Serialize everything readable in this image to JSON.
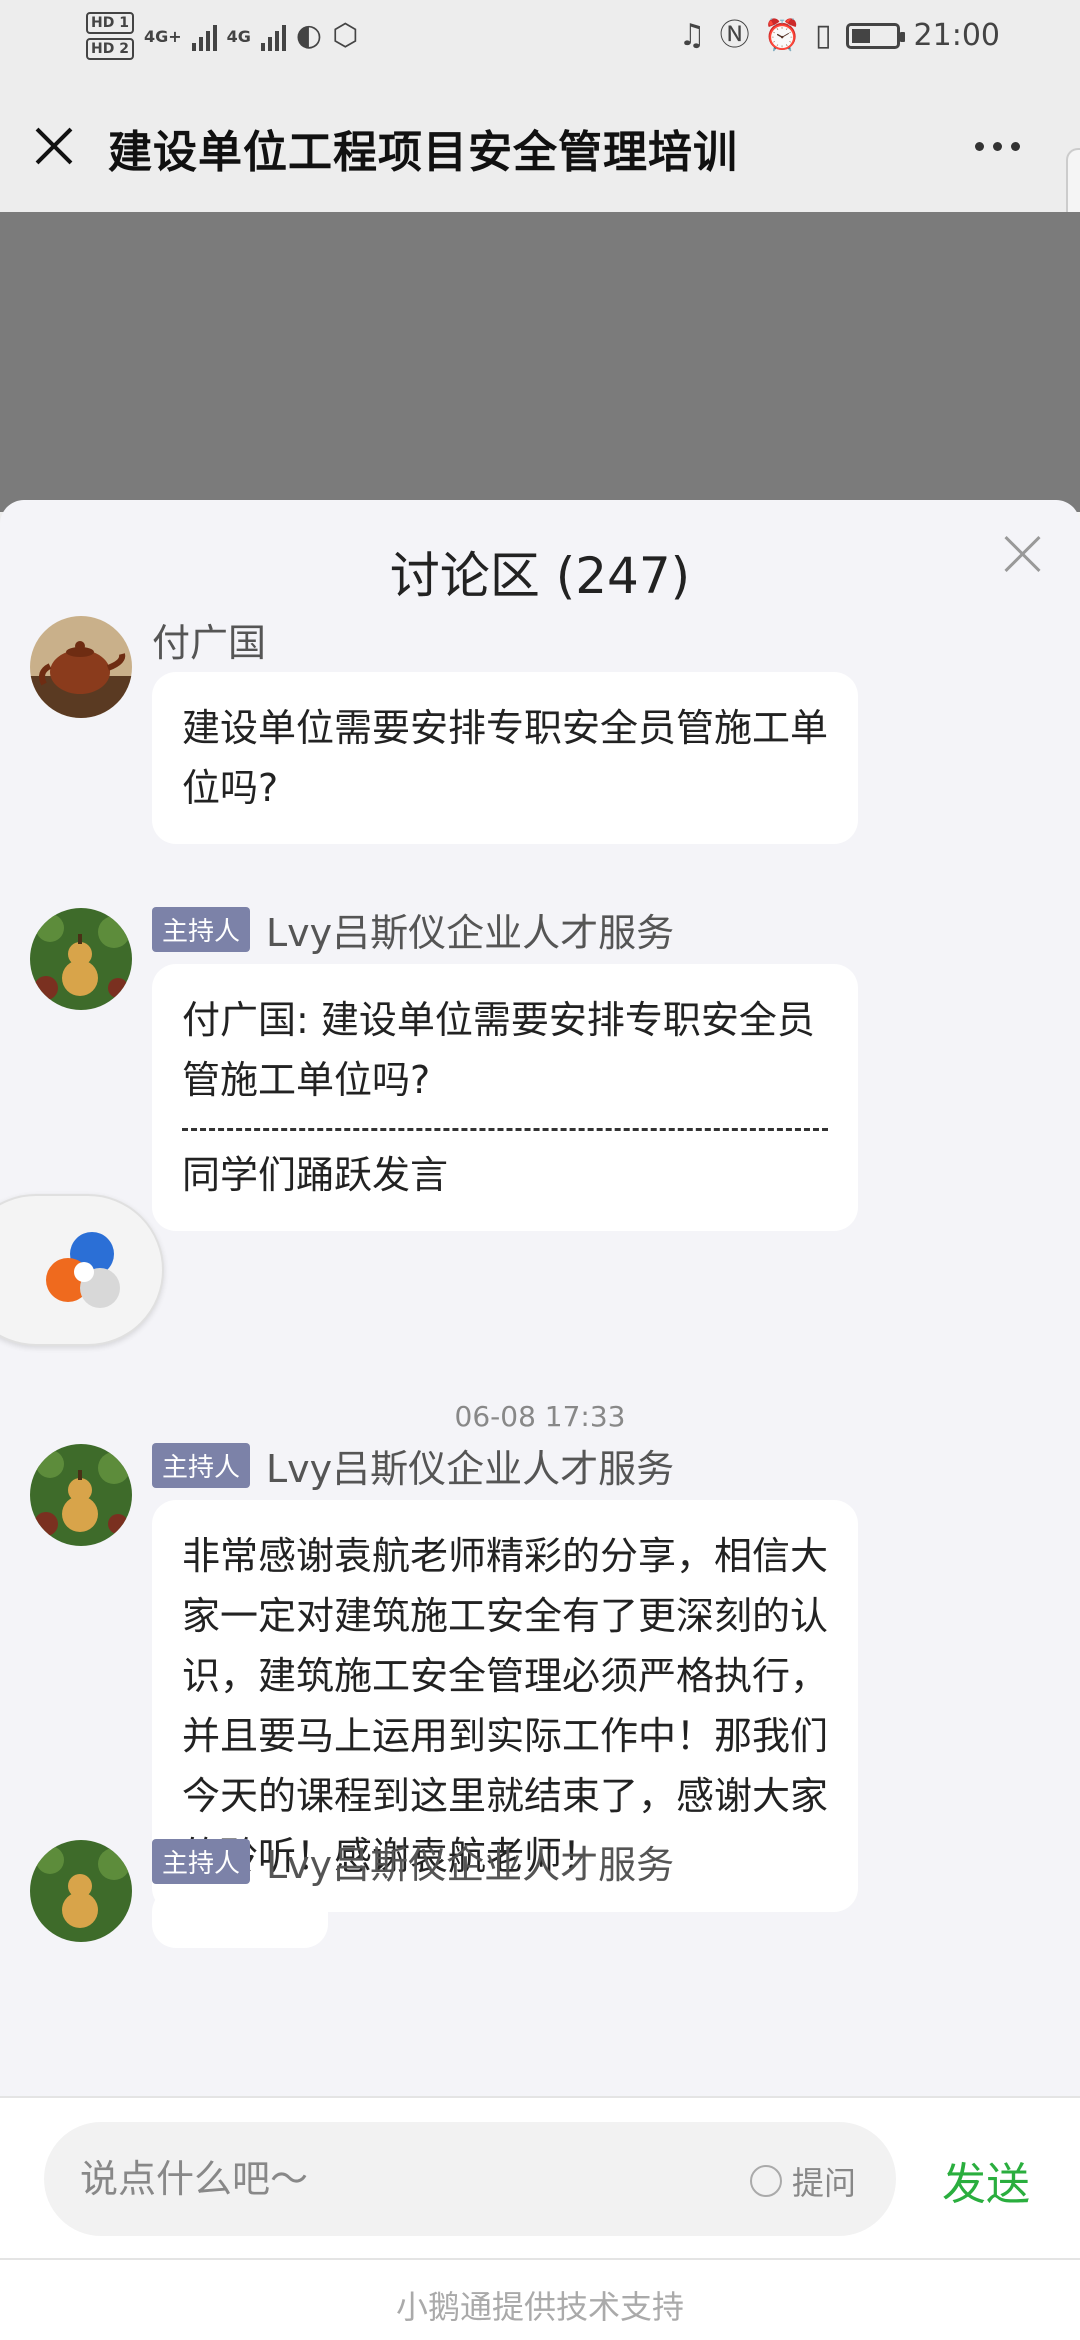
{
  "status_bar": {
    "time": "21:00",
    "network_1": "4G+",
    "network_2": "4G",
    "hd_1": "HD 1",
    "hd_2": "HD 2"
  },
  "header": {
    "title": "建设单位工程项目安全管理培训"
  },
  "discussion": {
    "title": "讨论区 (247)"
  },
  "messages": [
    {
      "sender": "付广国",
      "text": "建设单位需要安排专职安全员管施工单位吗?"
    },
    {
      "badge": "主持人",
      "sender": "Lvy吕斯仪企业人才服务",
      "quote": "付广国: 建设单位需要安排专职安全员管施工单位吗?",
      "text": "同学们踊跃发言"
    },
    {
      "badge": "主持人",
      "sender": "Lvy吕斯仪企业人才服务",
      "text": "非常感谢袁航老师精彩的分享，相信大家一定对建筑施工安全有了更深刻的认识，建筑施工安全管理必须严格执行，并且要马上运用到实际工作中！那我们今天的课程到这里就结束了，感谢大家的聆听！感谢袁航老师！"
    },
    {
      "badge": "主持人",
      "sender": "Lvy吕斯仪企业人才服务"
    }
  ],
  "timestamp": "06-08 17:33",
  "input": {
    "placeholder": "说点什么吧～",
    "ask_label": "提问",
    "send_label": "发送"
  },
  "footer": {
    "text": "小鹅通提供技术支持"
  },
  "colors": {
    "accent_green": "#2aae3e",
    "host_badge": "#7c82a8",
    "sheet_bg": "#f4f4f8"
  },
  "icons": {
    "close": "close-icon",
    "more": "more-dots-icon",
    "float": "xiaoe-logo-icon"
  }
}
